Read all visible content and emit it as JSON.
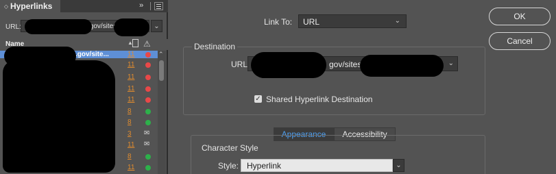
{
  "panel": {
    "title": "Hyperlinks",
    "collapse_glyph": "›› ",
    "url_label": "URL:",
    "url_value_visible": ".gov/sites",
    "columns": {
      "name": "Name"
    },
    "list": [
      {
        "name": ".gov/site...",
        "page": "11",
        "status": "red",
        "selected": true
      },
      {
        "name": "",
        "page": "11",
        "status": "red"
      },
      {
        "name": "",
        "page": "11",
        "status": "red"
      },
      {
        "name": "",
        "page": "11",
        "status": "red"
      },
      {
        "name": "",
        "page": "11",
        "status": "red"
      },
      {
        "name": "",
        "page": "8",
        "status": "green"
      },
      {
        "name": "",
        "page": "8",
        "status": "green"
      },
      {
        "name": "",
        "page": "3",
        "status": "mail"
      },
      {
        "name": "",
        "page": "11",
        "status": "mail"
      },
      {
        "name": "",
        "page": "8",
        "status": "green"
      },
      {
        "name": "",
        "page": "11",
        "status": "green"
      }
    ]
  },
  "dialog": {
    "link_to_label": "Link To:",
    "link_to_value": "URL",
    "destination_title": "Destination",
    "url_label": "URL:",
    "url_value_visible": "gov/sites",
    "shared_label": "Shared Hyperlink Destination",
    "shared_checked": true,
    "tabs": [
      "Appearance",
      "Accessibility"
    ],
    "active_tab": "Appearance",
    "char_style_title": "Character Style",
    "style_label": "Style:",
    "style_value": "Hyperlink",
    "ok_label": "OK",
    "cancel_label": "Cancel"
  },
  "colors": {
    "bg": "#535353",
    "selection": "#5e8fd6",
    "page_link": "#e08b2e",
    "status_red": "#e84848",
    "status_green": "#2db04a",
    "active_tab_text": "#4ea0f2"
  }
}
